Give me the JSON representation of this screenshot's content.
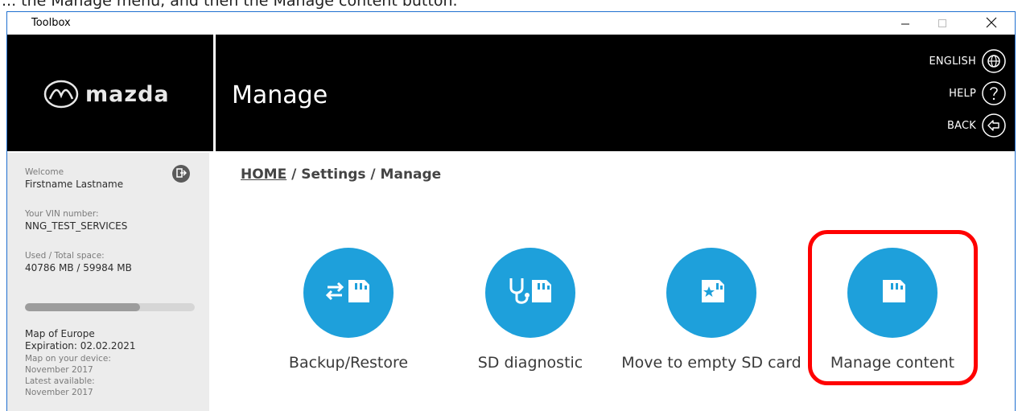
{
  "caption": {
    "text": "... the Manage menu, and then the Manage content button."
  },
  "window": {
    "title": "Toolbox",
    "controls": {
      "minimize_icon": "minimize-icon",
      "maximize_icon": "maximize-icon",
      "close_icon": "close-icon"
    }
  },
  "header": {
    "brand": "mazda",
    "title": "Manage",
    "links": [
      {
        "label": "ENGLISH",
        "icon": "globe-icon"
      },
      {
        "label": "HELP",
        "icon": "help-icon"
      },
      {
        "label": "BACK",
        "icon": "back-icon"
      }
    ]
  },
  "sidebar": {
    "welcome_label": "Welcome",
    "user_name": "Firstname Lastname",
    "vin_label": "Your VIN number:",
    "vin_value": "NNG_TEST_SERVICES",
    "space_label": "Used / Total space:",
    "space_value": "40786 MB / 59984 MB",
    "space_used_fraction": 0.68,
    "map_name": "Map of Europe",
    "expiration": "Expiration: 02.02.2021",
    "map_on_device_label": "Map on your device:",
    "map_on_device_value": "November 2017",
    "latest_label": "Latest available:",
    "latest_value": "November 2017",
    "logout_icon": "logout-icon"
  },
  "breadcrumb": {
    "home": "HOME",
    "rest": " / Settings / Manage"
  },
  "actions": [
    {
      "label": "Backup/Restore",
      "icon": "backup-restore-icon"
    },
    {
      "label": "SD diagnostic",
      "icon": "sd-diagnostic-icon"
    },
    {
      "label": "Move to empty SD card",
      "icon": "move-to-sd-icon"
    },
    {
      "label": "Manage content",
      "icon": "sd-card-icon"
    }
  ],
  "colors": {
    "accent_blue": "#1ea0db",
    "header_bg": "#000000",
    "sidebar_bg": "#ececec",
    "highlight_red": "#ff0000"
  }
}
